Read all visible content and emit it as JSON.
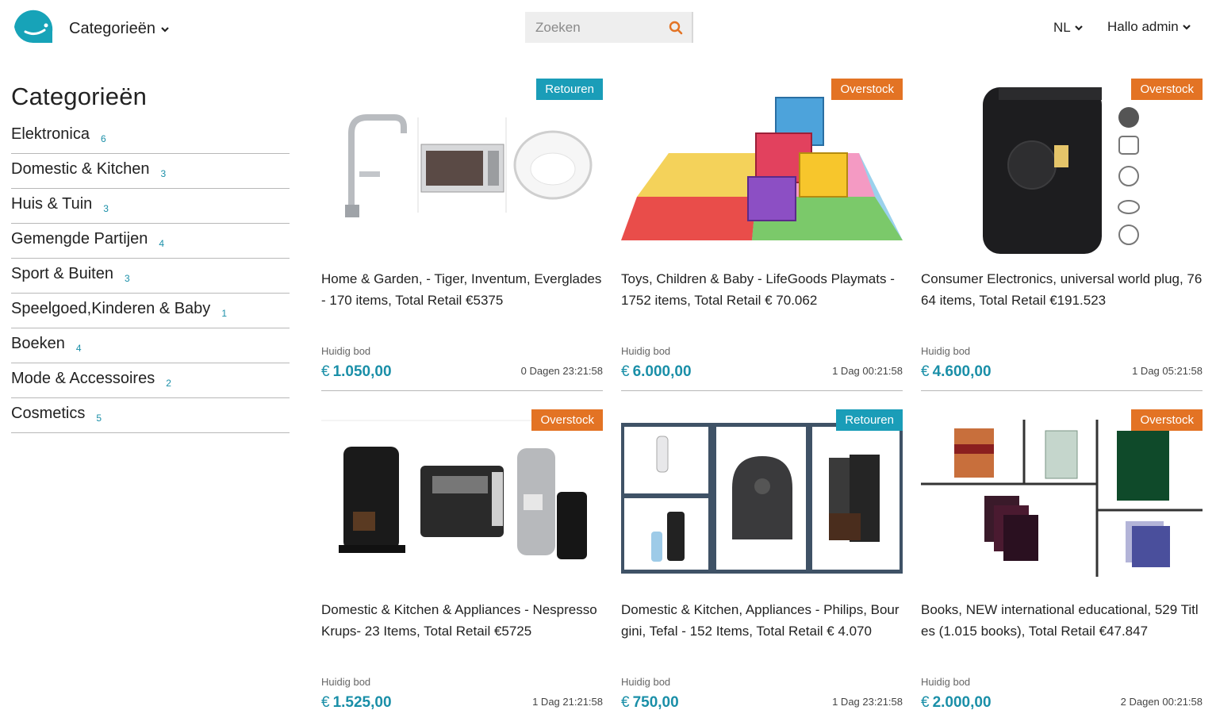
{
  "header": {
    "nav_categories": "Categorieën",
    "search_placeholder": "Zoeken",
    "language": "NL",
    "user_greeting": "Hallo admin"
  },
  "sidebar": {
    "title": "Categorieën",
    "items": [
      {
        "label": "Elektronica",
        "count": "6"
      },
      {
        "label": "Domestic & Kitchen",
        "count": "3"
      },
      {
        "label": "Huis & Tuin",
        "count": "3"
      },
      {
        "label": "Gemengde Partijen",
        "count": "4"
      },
      {
        "label": "Sport & Buiten",
        "count": "3"
      },
      {
        "label": "Speelgoed,Kinderen & Baby",
        "count": "1"
      },
      {
        "label": "Boeken",
        "count": "4"
      },
      {
        "label": "Mode & Accessoires",
        "count": "2"
      },
      {
        "label": "Cosmetics",
        "count": "5"
      }
    ]
  },
  "products": [
    {
      "badge": "Retouren",
      "title": "Home & Garden, - Tiger, Inventum, Everglades - 170 items, Total Retail €5375",
      "bid_label": "Huidig bod",
      "currency": "€",
      "price": "1.050,00",
      "timer": "0 Dagen 23:21:58"
    },
    {
      "badge": "Overstock",
      "title": "Toys, Children & Baby - LifeGoods Playmats - 1752 items, Total Retail € 70.062",
      "bid_label": "Huidig bod",
      "currency": "€",
      "price": "6.000,00",
      "timer": "1 Dag 00:21:58"
    },
    {
      "badge": "Overstock",
      "title": "Consumer Electronics, universal world plug, 7664 items, Total Retail €191.523",
      "bid_label": "Huidig bod",
      "currency": "€",
      "price": "4.600,00",
      "timer": "1 Dag 05:21:58"
    },
    {
      "badge": "Overstock",
      "title": "Domestic & Kitchen & Appliances - Nespresso Krups- 23 Items, Total Retail €5725",
      "bid_label": "Huidig bod",
      "currency": "€",
      "price": "1.525,00",
      "timer": "1 Dag 21:21:58"
    },
    {
      "badge": "Retouren",
      "title": "Domestic & Kitchen, Appliances - Philips, Bourgini, Tefal - 152 Items, Total Retail € 4.070",
      "bid_label": "Huidig bod",
      "currency": "€",
      "price": "750,00",
      "timer": "1 Dag 23:21:58"
    },
    {
      "badge": "Overstock",
      "title": "Books, NEW international educational, 529 Titles (1.015 books), Total Retail €47.847",
      "bid_label": "Huidig bod",
      "currency": "€",
      "price": "2.000,00",
      "timer": "2 Dagen 00:21:58"
    }
  ],
  "colors": {
    "accent": "#1a9db8",
    "overstock": "#e37324",
    "price": "#1a8fa8"
  }
}
